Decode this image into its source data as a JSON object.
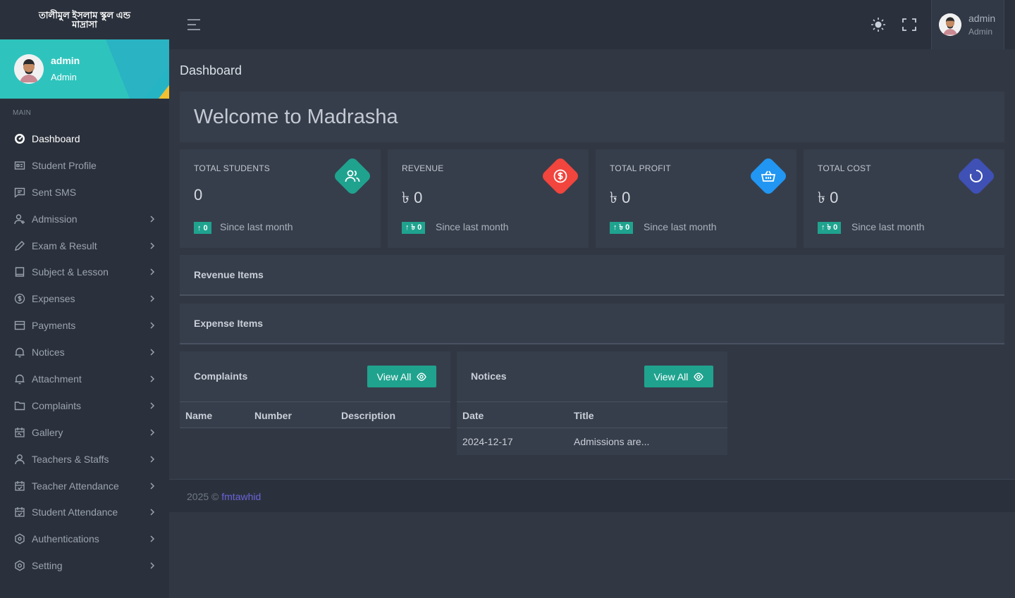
{
  "brand": {
    "title": "তালীমুল ইসলাম স্কুল এন্ড মাদ্রাসা"
  },
  "sidebar_profile": {
    "name": "admin",
    "role": "Admin"
  },
  "sidebar": {
    "section_label": "MAIN",
    "items": [
      {
        "label": "Dashboard",
        "icon": "dashboard-icon",
        "active": true,
        "has_submenu": false
      },
      {
        "label": "Student Profile",
        "icon": "id-card-icon",
        "has_submenu": false
      },
      {
        "label": "Sent SMS",
        "icon": "message-icon",
        "has_submenu": false
      },
      {
        "label": "Admission",
        "icon": "user-plus-icon",
        "has_submenu": true
      },
      {
        "label": "Exam & Result",
        "icon": "pencil-icon",
        "has_submenu": true
      },
      {
        "label": "Subject & Lesson",
        "icon": "book-icon",
        "has_submenu": true
      },
      {
        "label": "Expenses",
        "icon": "dollar-circle-icon",
        "has_submenu": true
      },
      {
        "label": "Payments",
        "icon": "credit-card-icon",
        "has_submenu": true
      },
      {
        "label": "Notices",
        "icon": "bell-icon",
        "has_submenu": true
      },
      {
        "label": "Attachment",
        "icon": "bell-icon",
        "has_submenu": true
      },
      {
        "label": "Complaints",
        "icon": "folder-icon",
        "has_submenu": true
      },
      {
        "label": "Gallery",
        "icon": "image-icon",
        "has_submenu": true
      },
      {
        "label": "Teachers & Staffs",
        "icon": "user-icon",
        "has_submenu": true
      },
      {
        "label": "Teacher Attendance",
        "icon": "calendar-check-icon",
        "has_submenu": true
      },
      {
        "label": "Student Attendance",
        "icon": "calendar-check-icon",
        "has_submenu": true
      },
      {
        "label": "Authentications",
        "icon": "hexagon-icon",
        "has_submenu": true
      },
      {
        "label": "Setting",
        "icon": "settings-icon",
        "has_submenu": true
      }
    ]
  },
  "topbar": {
    "user_name": "admin",
    "user_role": "Admin"
  },
  "page": {
    "title": "Dashboard",
    "welcome": "Welcome to Madrasha"
  },
  "stats": [
    {
      "label": "TOTAL STUDENTS",
      "value": "0",
      "badge": "↑ 0",
      "since": "Since last month",
      "color": "#1fa38f",
      "icon": "users-icon"
    },
    {
      "label": "REVENUE",
      "value": "৳ 0",
      "badge": "↑ ৳ 0",
      "since": "Since last month",
      "color": "#f1453d",
      "icon": "dollar-circle-icon"
    },
    {
      "label": "TOTAL PROFIT",
      "value": "৳ 0",
      "badge": "↑ ৳ 0",
      "since": "Since last month",
      "color": "#2196f3",
      "icon": "basket-icon"
    },
    {
      "label": "TOTAL COST",
      "value": "৳ 0",
      "badge": "↑ ৳ 0",
      "since": "Since last month",
      "color": "#3f51b5",
      "icon": "loader-icon"
    }
  ],
  "sections": {
    "revenue": "Revenue Items",
    "expense": "Expense Items"
  },
  "complaints": {
    "title": "Complaints",
    "button": "View All",
    "columns": [
      "Name",
      "Number",
      "Description"
    ]
  },
  "notices": {
    "title": "Notices",
    "button": "View All",
    "columns": [
      "Date",
      "Title"
    ],
    "rows": [
      {
        "date": "2024-12-17",
        "title": "Admissions are..."
      }
    ]
  },
  "footer": {
    "text": "2025 © ",
    "link": "fmtawhid"
  },
  "colors": {
    "accent": "#1fa38f",
    "sidebar_bg": "#2b313c",
    "page_bg": "#313844",
    "card_bg": "#373e4b"
  }
}
